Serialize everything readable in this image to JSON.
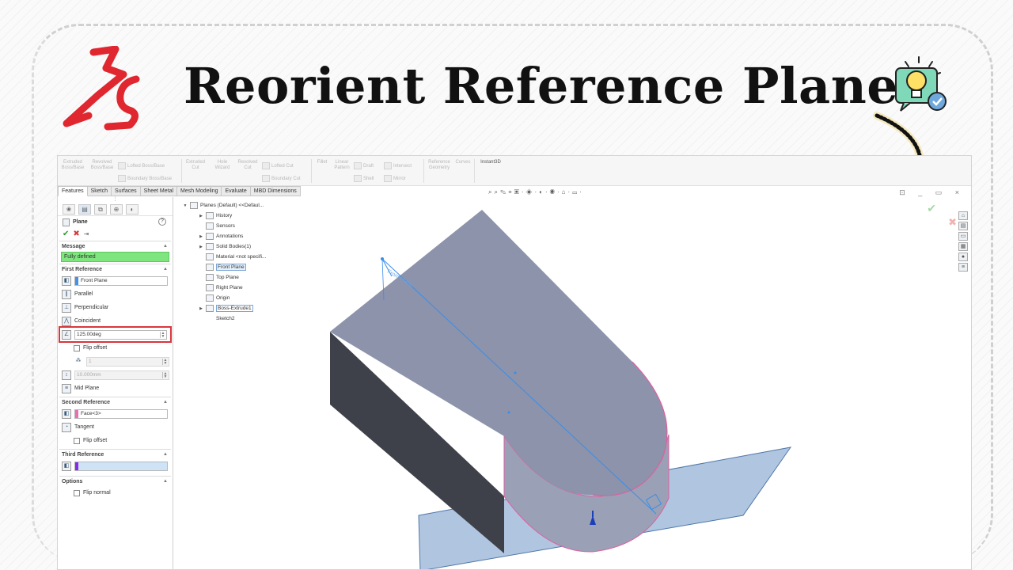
{
  "banner": {
    "title": "Reorient Reference Plane"
  },
  "colors": {
    "logo_red": "#e0272f",
    "highlight_red": "#d9363e",
    "message_green": "#7fe57f",
    "plane_blue": "#6f95c4",
    "body_gray": "#8c93ab"
  },
  "ribbon": {
    "groups": [
      {
        "label": "Extruded\nBoss/Base"
      },
      {
        "label": "Revolved\nBoss/Base"
      },
      {
        "label": "Lofted Boss/Base"
      },
      {
        "label": "Boundary Boss/Base"
      },
      {
        "label": "Extruded\nCut"
      },
      {
        "label": "Hole\nWizard"
      },
      {
        "label": "Revolved\nCut"
      },
      {
        "label": "Lofted Cut"
      },
      {
        "label": "Boundary Cut"
      },
      {
        "label": "Fillet"
      },
      {
        "label": "Linear\nPattern"
      },
      {
        "label": "Draft"
      },
      {
        "label": "Intersect"
      },
      {
        "label": "Shell"
      },
      {
        "label": "Mirror"
      },
      {
        "label": "Reference\nGeometry"
      },
      {
        "label": "Curves"
      },
      {
        "label": "Instant3D"
      }
    ]
  },
  "tabs": [
    "Features",
    "Sketch",
    "Surfaces",
    "Sheet Metal",
    "Mesh Modeling",
    "Evaluate",
    "MBD Dimensions"
  ],
  "property_manager": {
    "title": "Plane",
    "help": "?",
    "message_header": "Message",
    "message": "Fully defined",
    "first_reference": {
      "header": "First Reference",
      "selection": "Front Plane",
      "options": [
        "Parallel",
        "Perpendicular",
        "Coincident"
      ],
      "angle_value": "125.00deg",
      "flip_offset": "Flip offset",
      "count_value": "1",
      "distance_value": "10.000mm",
      "mid_plane": "Mid Plane"
    },
    "second_reference": {
      "header": "Second Reference",
      "selection": "Face<3>",
      "tangent": "Tangent",
      "flip_offset": "Flip offset"
    },
    "third_reference": {
      "header": "Third Reference",
      "selection": ""
    },
    "options": {
      "header": "Options",
      "flip_normal": "Flip normal"
    }
  },
  "feature_tree": {
    "root": "Planes (Default) <<Defaul...",
    "items": [
      {
        "label": "History",
        "expand": true
      },
      {
        "label": "Sensors",
        "expand": false
      },
      {
        "label": "Annotations",
        "expand": true
      },
      {
        "label": "Solid Bodies(1)",
        "expand": true
      },
      {
        "label": "Material <not specifi...",
        "expand": false
      },
      {
        "label": "Front Plane",
        "expand": false,
        "selected": true
      },
      {
        "label": "Top Plane",
        "expand": false
      },
      {
        "label": "Right Plane",
        "expand": false
      },
      {
        "label": "Origin",
        "expand": false
      },
      {
        "label": "Boss-Extrude1",
        "expand": true
      },
      {
        "label": "Sketch2",
        "expand": false
      }
    ]
  },
  "viewport": {
    "plane_label": "Front Plane"
  }
}
